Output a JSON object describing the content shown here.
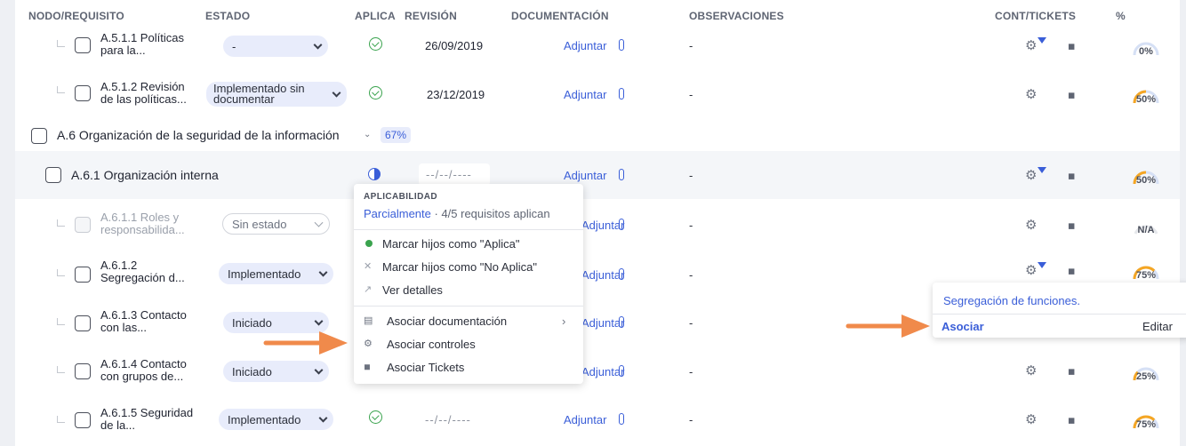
{
  "header": {
    "nodo": "NODO/REQUISITO",
    "estado": "ESTADO",
    "aplica": "APLICA",
    "revision": "REVISIÓN",
    "documentacion": "DOCUMENTACIÓN",
    "observaciones": "OBSERVACIONES",
    "cont_tickets": "CONT/TICKETS",
    "percent": "%"
  },
  "rows": {
    "r1": {
      "name_l1": "A.5.1.1 Políticas",
      "name_l2": "para la...",
      "estado": "-",
      "revision": "26/09/2019",
      "doc": "Adjuntar",
      "obs": "-",
      "pct": "0%"
    },
    "r2": {
      "name_l1": "A.5.1.2 Revisión",
      "name_l2": "de las políticas...",
      "estado_l1": "Implementado sin",
      "estado_l2": "documentar",
      "revision": "23/12/2019",
      "doc": "Adjuntar",
      "obs": "-",
      "pct": "50%"
    },
    "section": {
      "name": "A.6 Organización de la seguridad de la información",
      "badge": "67%"
    },
    "r3": {
      "name": "A.6.1 Organización interna",
      "revision": "--/--/----",
      "doc": "Adjuntar",
      "obs": "-",
      "pct": "50%"
    },
    "r4": {
      "name_l1": "A.6.1.1 Roles y",
      "name_l2": "responsabilida...",
      "estado": "Sin estado",
      "doc": "Adjuntar",
      "obs": "-",
      "pct": "N/A"
    },
    "r5": {
      "name_l1": "A.6.1.2",
      "name_l2": "Segregación d...",
      "estado": "Implementado",
      "doc": "Adjuntar",
      "obs": "-",
      "pct": "75%"
    },
    "r6": {
      "name_l1": "A.6.1.3 Contacto",
      "name_l2": "con las...",
      "estado": "Iniciado",
      "doc": "Adjuntar",
      "obs": "-",
      "pct": ""
    },
    "r7": {
      "name_l1": "A.6.1.4 Contacto",
      "name_l2": "con grupos de...",
      "estado": "Iniciado",
      "doc": "Adjuntar",
      "obs": "-",
      "pct": "25%"
    },
    "r8": {
      "name_l1": "A.6.1.5 Seguridad",
      "name_l2": "de la...",
      "estado": "Implementado",
      "revision": "--/--/----",
      "doc": "Adjuntar",
      "obs": "-",
      "pct": "75%"
    }
  },
  "applicability_menu": {
    "title": "APLICABILIDAD",
    "status": "Parcialmente",
    "detail": "· 4/5 requisitos aplican",
    "mark_apply": "Marcar hijos como \"Aplica\"",
    "mark_no_apply": "Marcar hijos como \"No Aplica\"",
    "details": "Ver detalles",
    "assoc_doc": "Asociar documentación",
    "assoc_controls": "Asociar controles",
    "assoc_tickets": "Asociar Tickets"
  },
  "control_popover": {
    "title": "Segregación de funciones.",
    "associate": "Asociar",
    "edit": "Editar"
  },
  "colors": {
    "accent": "#3a5ed8",
    "check_green": "#3aa34e",
    "gauge_orange": "#f5a623",
    "arrow_orange": "#f08a4b"
  },
  "gauges": {
    "r1": 0,
    "r2": 0.5,
    "r3": 0.5,
    "r5": 0.75,
    "r7": 0.25,
    "r8": 0.75
  }
}
